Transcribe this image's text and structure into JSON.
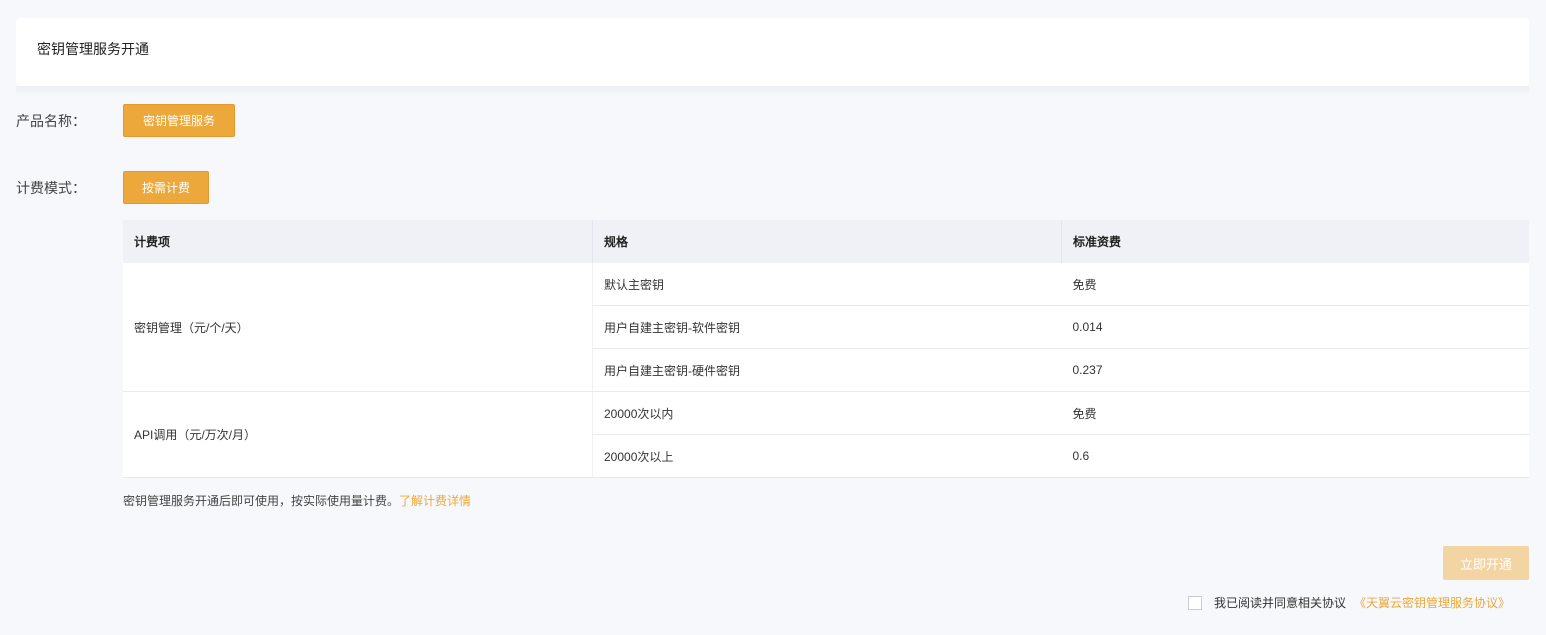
{
  "header": {
    "title": "密钥管理服务开通"
  },
  "product": {
    "label": "产品名称：",
    "value": "密钥管理服务"
  },
  "billing": {
    "label": "计费模式：",
    "value": "按需计费"
  },
  "table": {
    "columns": [
      "计费项",
      "规格",
      "标准资费"
    ],
    "groups": [
      {
        "name": "密钥管理（元/个/天）",
        "rows": [
          {
            "spec": "默认主密钥",
            "price": "免费"
          },
          {
            "spec": "用户自建主密钥-软件密钥",
            "price": "0.014"
          },
          {
            "spec": "用户自建主密钥-硬件密钥",
            "price": "0.237"
          }
        ]
      },
      {
        "name": "API调用（元/万次/月）",
        "rows": [
          {
            "spec": "20000次以内",
            "price": "免费"
          },
          {
            "spec": "20000次以上",
            "price": "0.6"
          }
        ]
      }
    ]
  },
  "note": {
    "text": "密钥管理服务开通后即可使用，按实际使用量计费。",
    "link": "了解计费详情"
  },
  "actions": {
    "open_label": "立即开通"
  },
  "agreement": {
    "text": "我已阅读并同意相关协议",
    "link": "《天翼云密钥管理服务协议》",
    "checked": false
  },
  "colors": {
    "accent": "#eca83a",
    "accent_disabled": "#f3d4a3",
    "background": "#f7f8fb"
  }
}
